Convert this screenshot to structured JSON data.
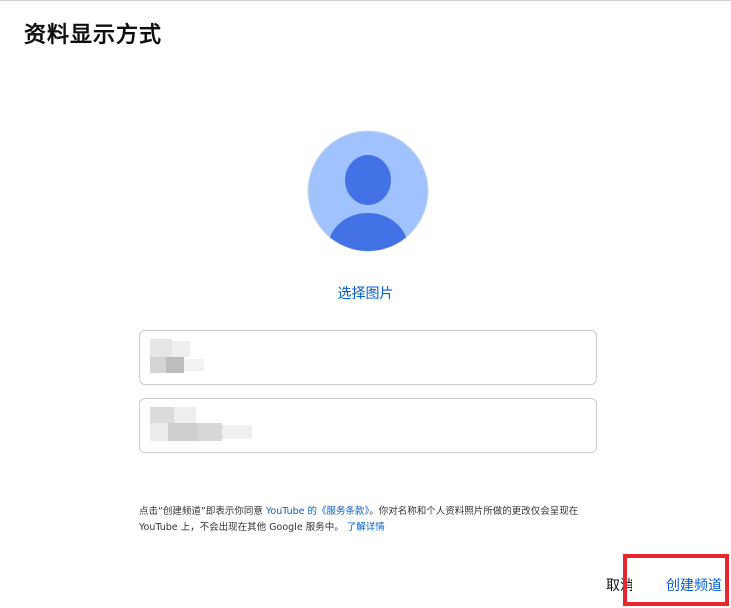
{
  "dialog": {
    "title": "资料显示方式"
  },
  "avatar": {
    "icon": "default-avatar-icon",
    "bg_color": "#a0c3ff",
    "fg_color": "#4372e6"
  },
  "select_photo_label": "选择图片",
  "fields": {
    "name_value": "",
    "handle_value": ""
  },
  "terms": {
    "part1": "点击“创建频道”即表示你同意 ",
    "link_terms": "YouTube 的《服务条款》",
    "part2": "。你对名称和个人资料照片所做的更改仅会呈现在 YouTube 上，不会出现在其他 Google 服务中。",
    "link_learn": "了解详情"
  },
  "buttons": {
    "cancel_label": "取消",
    "create_label": "创建频道"
  },
  "colors": {
    "link_blue": "#065fd4",
    "highlight_red": "#e8262e"
  }
}
